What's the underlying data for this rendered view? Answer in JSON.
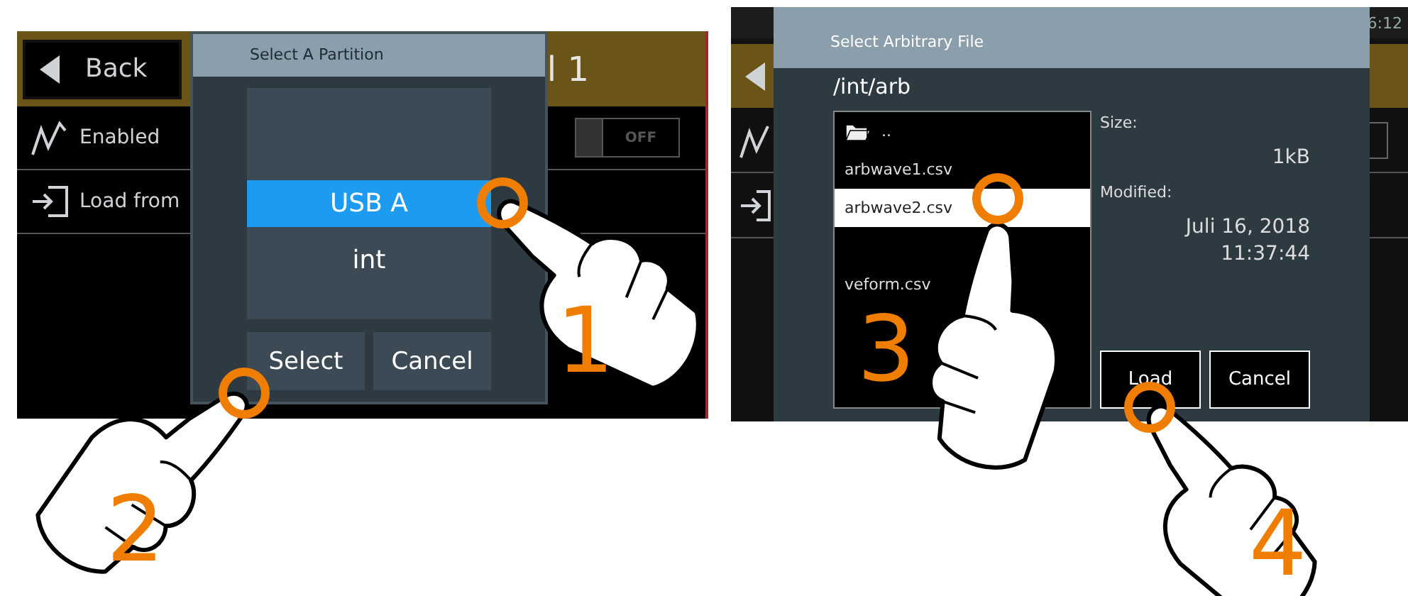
{
  "left_screen": {
    "header": {
      "back_button": "Back",
      "title": "l 1"
    },
    "rows": [
      {
        "kind": "toggle",
        "label": "Enabled",
        "toggle": {
          "on": false,
          "label": "OFF"
        }
      },
      {
        "kind": "link",
        "label": "Load from"
      }
    ],
    "dialog": {
      "title": "Select A Partition",
      "partitions": [
        {
          "label": "USB A",
          "selected": true
        },
        {
          "label": "int",
          "selected": false
        }
      ],
      "buttons": [
        "Select",
        "Cancel"
      ]
    }
  },
  "right_screen": {
    "status_time": "6:12",
    "background_toggle": {
      "on": false
    },
    "dialog": {
      "title": "Select Arbitrary File",
      "path": "/int/arb",
      "files": [
        {
          "kind": "folder",
          "name": "..",
          "selected": false
        },
        {
          "kind": "file",
          "name": "arbwave1.csv",
          "selected": false
        },
        {
          "kind": "file",
          "name": "arbwave2.csv",
          "selected": true
        },
        {
          "kind": "file",
          "name": "veform.csv",
          "selected": false
        }
      ],
      "size_label": "Size:",
      "size": "1kB",
      "modified_label": "Modified:",
      "modified_date": "Juli 16, 2018",
      "modified_time": "11:37:44",
      "buttons": [
        "Load",
        "Cancel"
      ]
    }
  },
  "steps": [
    {
      "number": "1"
    },
    {
      "number": "2"
    },
    {
      "number": "3"
    },
    {
      "number": "4"
    }
  ]
}
